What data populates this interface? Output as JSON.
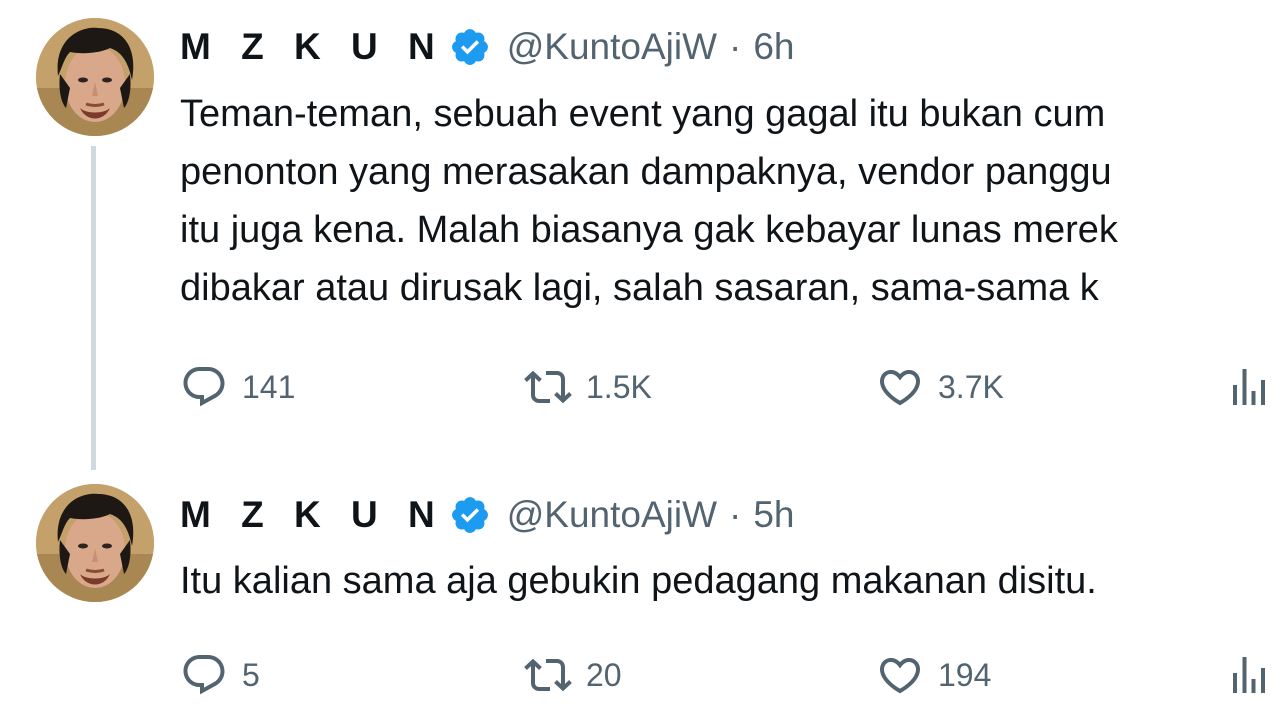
{
  "colors": {
    "text": "#0f1419",
    "secondary": "#536471",
    "verified": "#1d9bf0",
    "thread_line": "#cfd9de"
  },
  "tweets": [
    {
      "author": {
        "display_name": "M Z K U N",
        "handle": "@KuntoAjiW",
        "verified": true,
        "avatar_icon": "profile-photo"
      },
      "separator": "·",
      "time": "6h",
      "lines": [
        "Teman-teman, sebuah event yang gagal itu bukan cum",
        "penonton yang merasakan dampaknya, vendor panggu",
        "itu juga kena. Malah biasanya gak kebayar lunas merek",
        "dibakar atau dirusak lagi, salah sasaran, sama-sama k"
      ],
      "stats": {
        "replies": "141",
        "retweets": "1.5K",
        "likes": "3.7K"
      },
      "action_icons": [
        "reply-icon",
        "retweet-icon",
        "like-icon",
        "views-icon"
      ]
    },
    {
      "author": {
        "display_name": "M Z K U N",
        "handle": "@KuntoAjiW",
        "verified": true,
        "avatar_icon": "profile-photo"
      },
      "separator": "·",
      "time": "5h",
      "lines": [
        "Itu kalian sama aja gebukin pedagang makanan disitu."
      ],
      "stats": {
        "replies": "5",
        "retweets": "20",
        "likes": "194"
      },
      "action_icons": [
        "reply-icon",
        "retweet-icon",
        "like-icon",
        "views-icon"
      ]
    }
  ]
}
